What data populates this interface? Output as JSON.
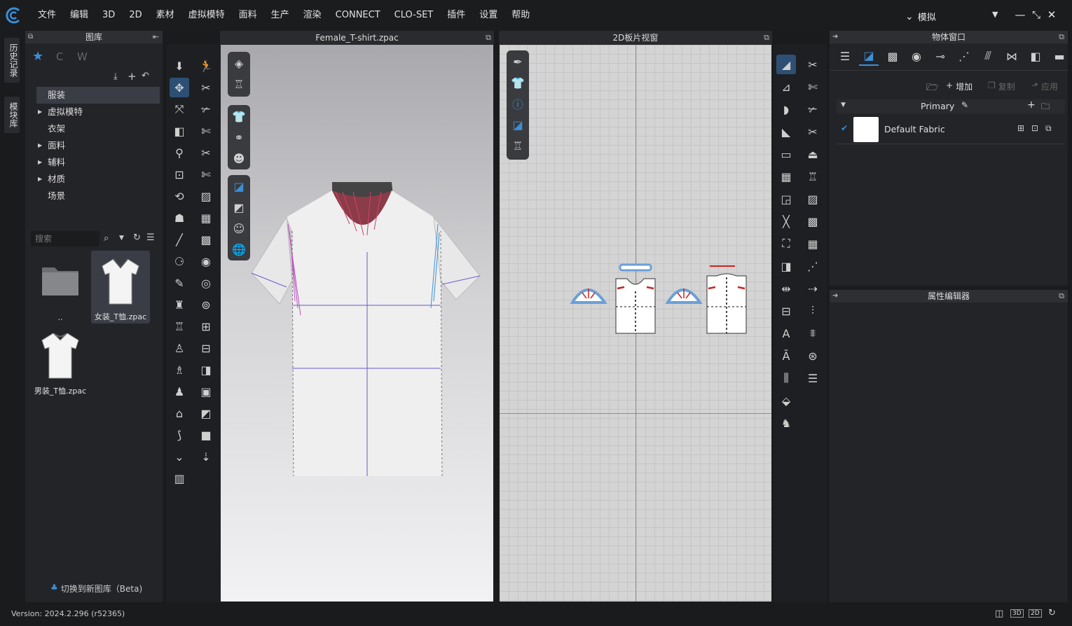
{
  "menu": {
    "items": [
      "文件",
      "编辑",
      "3D",
      "2D",
      "素材",
      "虚拟模特",
      "面料",
      "生产",
      "渲染",
      "CONNECT",
      "CLO-SET",
      "插件",
      "设置",
      "帮助"
    ],
    "mode_label": "模拟"
  },
  "side_tabs": {
    "history": "历史记录",
    "modules": "模块库"
  },
  "library": {
    "title": "图库",
    "tree": [
      {
        "label": "服装",
        "expandable": false,
        "selected": true
      },
      {
        "label": "虚拟模特",
        "expandable": true
      },
      {
        "label": "衣架",
        "expandable": false
      },
      {
        "label": "面料",
        "expandable": true
      },
      {
        "label": "辅料",
        "expandable": true
      },
      {
        "label": "材质",
        "expandable": true
      },
      {
        "label": "场景",
        "expandable": false
      }
    ],
    "search_placeholder": "搜索",
    "files": [
      {
        "name": "..",
        "type": "folder"
      },
      {
        "name": "女装_T恤.zpac",
        "type": "garment",
        "selected": true
      },
      {
        "name": "男装_T恤.zpac",
        "type": "garment"
      }
    ],
    "switch_label": "切换到新图库（Beta)"
  },
  "view3d": {
    "title": "Female_T-shirt.zpac"
  },
  "view2d": {
    "title": "2D板片视窗"
  },
  "object_window": {
    "title": "物体窗口",
    "add_label": "增加",
    "copy_label": "复制",
    "apply_label": "应用",
    "colorway": "Primary",
    "fabric_name": "Default Fabric"
  },
  "property_editor": {
    "title": "属性编辑器"
  },
  "status": {
    "version": "Version: 2024.2.296 (r52365)",
    "btn3d": "3D",
    "btn2d": "2D"
  },
  "colors": {
    "accent": "#3a8fd8",
    "stitch_red": "#d02020"
  }
}
